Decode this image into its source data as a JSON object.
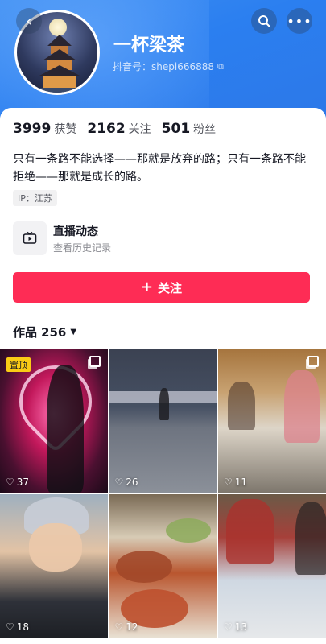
{
  "profile": {
    "nickname": "一杯梁茶",
    "account_id": "抖音号：shepi666888",
    "stats": [
      {
        "value": "3999",
        "label": "获赞"
      },
      {
        "value": "2162",
        "label": "关注"
      },
      {
        "value": "501",
        "label": "粉丝"
      }
    ],
    "bio": "只有一条路不能选择——那就是放弃的路；只有一条路不能拒绝——那就是成长的路。",
    "ip": "IP：江苏"
  },
  "live": {
    "title": "直播动态",
    "subtitle": "查看历史记录",
    "icon": "tv-icon"
  },
  "follow_button": {
    "label": "关注",
    "icon": "plus-icon"
  },
  "works": {
    "label": "作品",
    "count": "256"
  },
  "videos": [
    {
      "likes": "37",
      "pinned_label": "置顶",
      "multi": true
    },
    {
      "likes": "26",
      "multi": false
    },
    {
      "likes": "11",
      "multi": true
    },
    {
      "likes": "18",
      "multi": false
    },
    {
      "likes": "12",
      "multi": false
    },
    {
      "likes": "13",
      "multi": false
    }
  ],
  "colors": {
    "accent": "#fe2c55",
    "header_blue": "#2b7ff0",
    "pin_badge": "#facc15"
  }
}
